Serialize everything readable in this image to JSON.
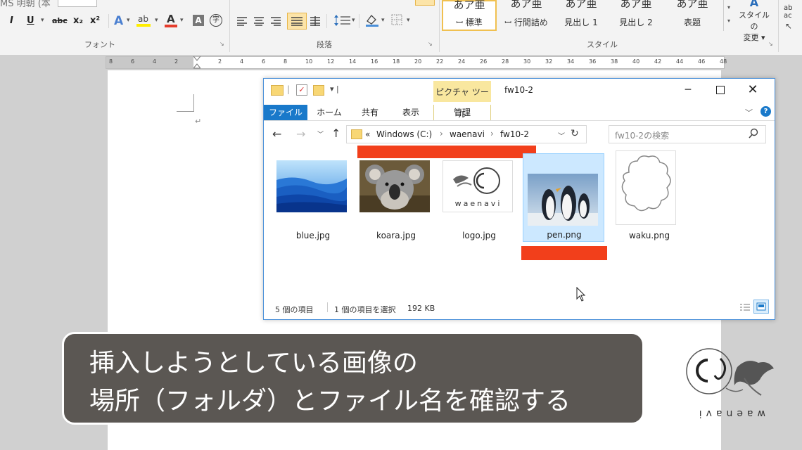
{
  "ribbon": {
    "format_buttons": [
      "I",
      "U",
      "abc",
      "x₂",
      "x²"
    ],
    "font_group_label": "フォント",
    "paragraph_group_label": "段落",
    "style_group_label": "スタイル",
    "style_tiles": [
      {
        "preview": "あア亜",
        "label": "標準"
      },
      {
        "preview": "あア亜",
        "label": "行間詰め"
      },
      {
        "preview": "あア亜",
        "label": "見出し 1"
      },
      {
        "preview": "あア亜",
        "label": "見出し 2"
      },
      {
        "preview": "あア亜",
        "label": "表題"
      }
    ],
    "styles_button_line1": "スタイルの",
    "styles_button_line2": "変更 ▾"
  },
  "ruler": {
    "ticks": [
      "8",
      "6",
      "4",
      "2",
      "",
      "2",
      "4",
      "6",
      "8",
      "10",
      "12",
      "14",
      "16",
      "18",
      "20",
      "22",
      "24",
      "26",
      "28",
      "30",
      "32",
      "34",
      "36",
      "38",
      "40",
      "42",
      "44",
      "46",
      "48"
    ]
  },
  "explorer": {
    "title": "fw10-2",
    "contextual_tab": "ピクチャ ツール",
    "tabs": {
      "file": "ファイル",
      "home": "ホーム",
      "share": "共有",
      "view": "表示",
      "manage": "管理"
    },
    "address": {
      "prefix": "«",
      "crumbs": [
        "Windows (C:)",
        "waenavi",
        "fw10-2"
      ]
    },
    "search_placeholder": "fw10-2の検索",
    "files": [
      {
        "name": "blue.jpg"
      },
      {
        "name": "koara.jpg"
      },
      {
        "name": "logo.jpg"
      },
      {
        "name": "pen.png"
      },
      {
        "name": "waku.png"
      }
    ],
    "status_count": "5 個の項目",
    "status_selected": "1 個の項目を選択",
    "status_size": "192 KB"
  },
  "caption": {
    "line1": "挿入しようとしている画像の",
    "line2": "場所（フォルダ）とファイル名を確認する"
  },
  "logo": {
    "text": "waenavi"
  },
  "colors": {
    "accent": "#1979ca",
    "highlight": "#f23f1b",
    "caption_bg": "#5b5753"
  }
}
